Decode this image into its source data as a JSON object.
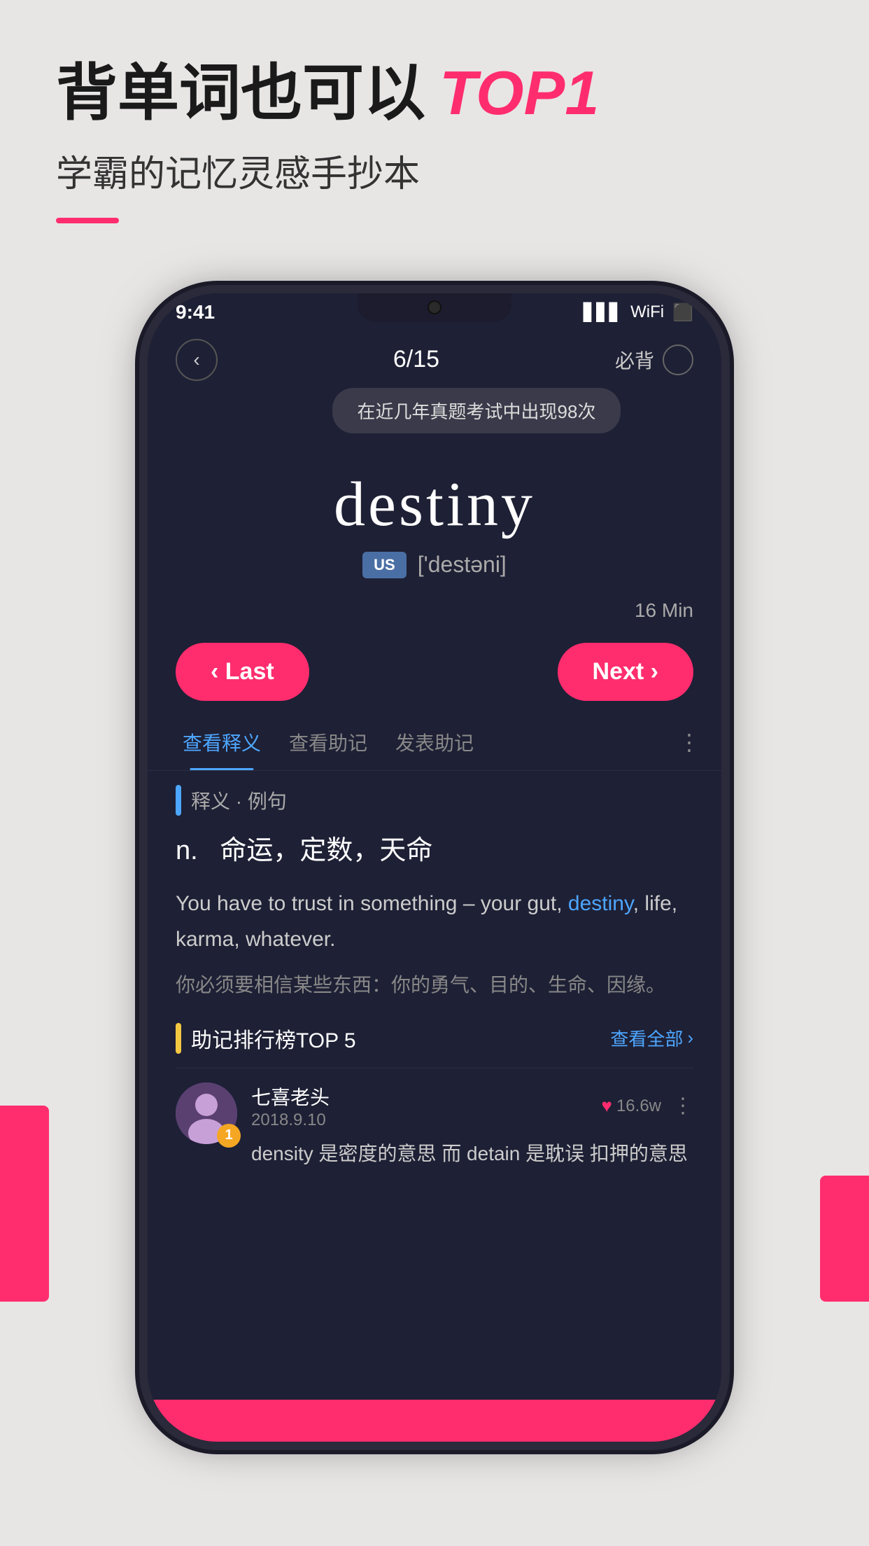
{
  "page": {
    "background_color": "#e8e5e5"
  },
  "header": {
    "title_part1": "背单词也可以",
    "title_highlight": "TOP1",
    "subtitle": "学霸的记忆灵感手抄本"
  },
  "phone": {
    "status": {
      "time": "9:41",
      "signal": "●●●",
      "wifi": "▲",
      "battery": "▌"
    },
    "nav": {
      "back_label": "‹",
      "progress": "6/15",
      "must_label": "必背"
    },
    "tooltip": "在近几年真题考试中出现98次",
    "word": {
      "text": "destiny",
      "phonetic_badge": "US",
      "phonetic": "['destəni]"
    },
    "timer": "16 Min",
    "buttons": {
      "last_label": "‹ Last",
      "next_label": "Next ›"
    },
    "tabs": [
      {
        "label": "查看释义",
        "active": true
      },
      {
        "label": "查看助记",
        "active": false
      },
      {
        "label": "发表助记",
        "active": false
      }
    ],
    "tab_more": "⋮",
    "definition_section": {
      "header": "释义 · 例句",
      "pos": "n.",
      "meanings": "命运，定数，天命",
      "example_en_before": "You have to trust in something – your gut, ",
      "example_en_word": "destiny",
      "example_en_after": ", life, karma, whatever.",
      "example_zh": "你必须要相信某些东西：你的勇气、目的、生命、因缘。"
    },
    "ranking_section": {
      "header": "助记排行榜TOP 5",
      "view_all": "查看全部",
      "entries": [
        {
          "rank": "1",
          "avatar_char": "👩",
          "username": "七喜老头",
          "date": "2018.9.10",
          "likes": "16.6w",
          "mnemonic_text": "density 是密度的意思 而 detain 是耽误 扣押的意思"
        }
      ]
    }
  }
}
